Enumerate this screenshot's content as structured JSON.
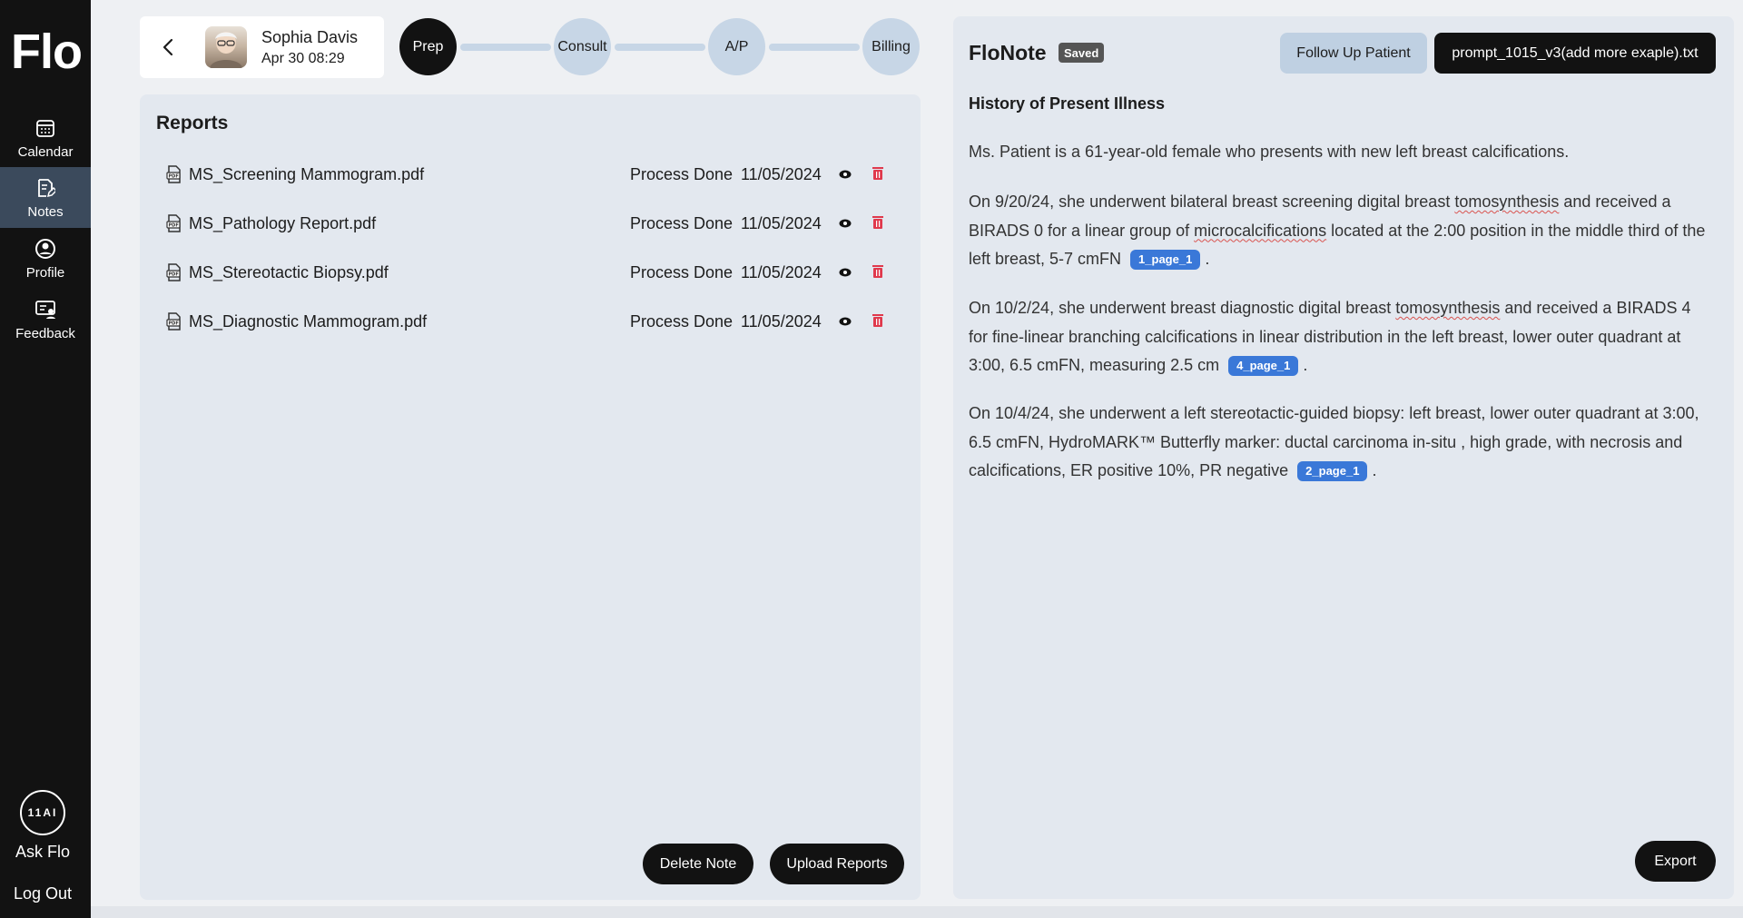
{
  "app": {
    "logo": "Flo"
  },
  "sidebar": {
    "items": [
      {
        "label": "Calendar",
        "icon": "calendar-icon"
      },
      {
        "label": "Notes",
        "icon": "notes-icon",
        "active": true
      },
      {
        "label": "Profile",
        "icon": "profile-icon"
      },
      {
        "label": "Feedback",
        "icon": "feedback-icon"
      }
    ],
    "ask_flo_logo": "11AI",
    "ask_flo_label": "Ask Flo",
    "logout_label": "Log Out"
  },
  "patient": {
    "name": "Sophia Davis",
    "datetime": "Apr 30 08:29"
  },
  "stepper": {
    "steps": [
      "Prep",
      "Consult",
      "A/P",
      "Billing"
    ],
    "active": "Prep"
  },
  "reports": {
    "title": "Reports",
    "rows": [
      {
        "name": "MS_Screening Mammogram.pdf",
        "status": "Process Done",
        "date": "11/05/2024"
      },
      {
        "name": "MS_Pathology Report.pdf",
        "status": "Process Done",
        "date": "11/05/2024"
      },
      {
        "name": "MS_Stereotactic Biopsy.pdf",
        "status": "Process Done",
        "date": "11/05/2024"
      },
      {
        "name": "MS_Diagnostic Mammogram.pdf",
        "status": "Process Done",
        "date": "11/05/2024"
      }
    ],
    "delete_note_label": "Delete Note",
    "upload_reports_label": "Upload Reports"
  },
  "note": {
    "title": "FloNote",
    "saved_badge": "Saved",
    "follow_up_label": "Follow Up Patient",
    "prompt_file_label": "prompt_1015_v3(add more exaple).txt",
    "section_heading": "History of Present Illness",
    "para1": "Ms. Patient is a 61-year-old female who presents with new left breast calcifications.",
    "para2": {
      "t1": "On 9/20/24, she underwent bilateral breast screening digital breast ",
      "w1": "tomosynthesis",
      "t2": " and received a BIRADS 0 for a linear group of ",
      "w2": "microcalcifications",
      "t3": " located at the 2:00 position in the middle third of the left breast, 5-7 cmFN",
      "cite": "1_page_1",
      "end": " ."
    },
    "para3": {
      "t1": "On 10/2/24, she underwent breast diagnostic digital breast ",
      "w1": "tomosynthesis",
      "t2": " and received a BIRADS 4 for fine-linear branching calcifications in linear distribution in the left breast, lower outer quadrant at 3:00, 6.5 cmFN, measuring 2.5 cm",
      "cite": "4_page_1",
      "end": " ."
    },
    "para4": {
      "t1": "On 10/4/24, she underwent a left stereotactic-guided biopsy: left breast, lower outer quadrant at 3:00, 6.5 cmFN, HydroMARK™ Butterfly marker: ductal carcinoma in-situ , high grade, with necrosis and calcifications, ER positive 10%, PR negative",
      "cite": "2_page_1",
      "end": " ."
    },
    "export_label": "Export"
  },
  "colors": {
    "sidebar_bg": "#121212",
    "active_nav_bg": "#3b4a5c",
    "panel_bg": "#e3e8ef",
    "stepper_inactive": "#c7d6e6",
    "citation_badge": "#3a78d8",
    "delete_icon": "#e0394c"
  }
}
